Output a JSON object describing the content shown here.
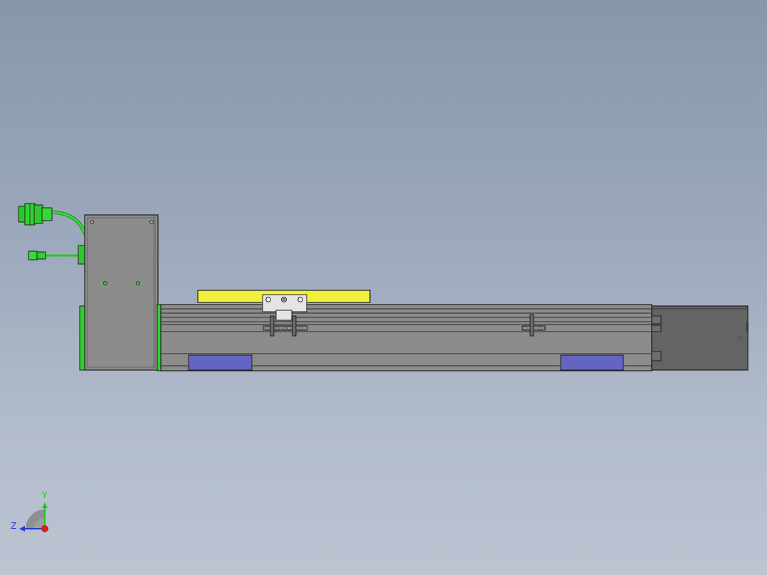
{
  "colors": {
    "background_top": "#8797ab",
    "background_bottom": "#bcc4d2",
    "body_gray": "#8a8a8a",
    "motor_dark": "#646464",
    "carriage_yellow": "#f2ef3a",
    "cable_green": "#22cc22",
    "end_cap_green": "#2fcf2f",
    "stopper_blue": "#6464c4",
    "outline": "#1e1e1e",
    "axis_y": "#22c522",
    "axis_z": "#2b3ad6",
    "axis_origin": "#e01b1b"
  },
  "triad": {
    "y_label": "Y",
    "z_label": "Z"
  }
}
